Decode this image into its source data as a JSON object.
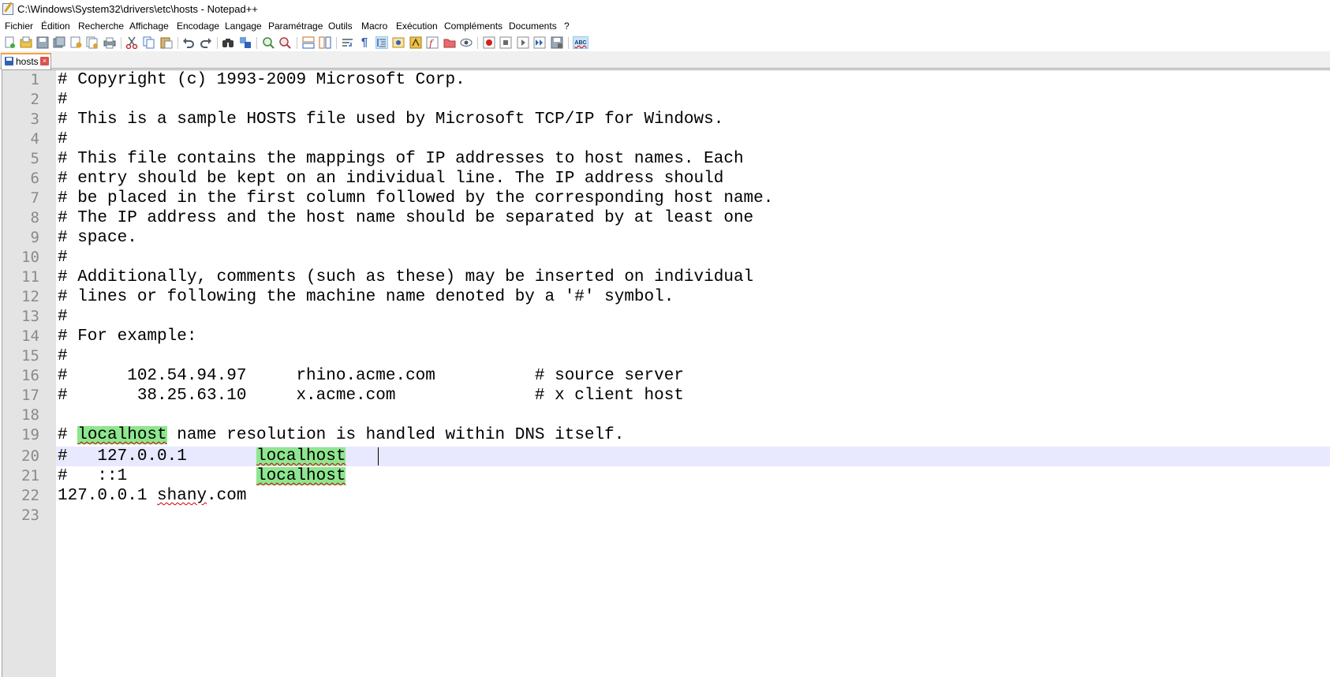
{
  "window": {
    "title": "C:\\Windows\\System32\\drivers\\etc\\hosts - Notepad++"
  },
  "menu": [
    "Fichier",
    "Édition",
    "Recherche",
    "Affichage",
    "Encodage",
    "Langage",
    "Paramétrage",
    "Outils",
    "Macro",
    "Exécution",
    "Compléments",
    "Documents",
    "?"
  ],
  "toolbar": {
    "icons": [
      "new-file-icon",
      "open-file-icon",
      "save-icon",
      "save-all-icon",
      "close-icon",
      "close-all-icon",
      "print-icon",
      "cut-icon",
      "copy-icon",
      "paste-icon",
      "undo-icon",
      "redo-icon",
      "find-icon",
      "replace-icon",
      "zoom-in-icon",
      "zoom-out-icon",
      "sync-vertical-icon",
      "sync-horizontal-icon",
      "word-wrap-icon",
      "show-all-characters-icon",
      "indent-guide-icon",
      "user-language-icon",
      "document-map-icon",
      "function-list-icon",
      "folder-workspace-icon",
      "monitoring-icon",
      "record-macro-icon",
      "stop-macro-icon",
      "play-macro-icon",
      "run-macro-multiple-icon",
      "save-macro-icon",
      "spell-check-icon"
    ],
    "spell_check_label": "ABC"
  },
  "tab": {
    "label": "hosts",
    "close_glyph": "×"
  },
  "editor": {
    "line_numbers": [
      "1",
      "2",
      "3",
      "4",
      "5",
      "6",
      "7",
      "8",
      "9",
      "10",
      "11",
      "12",
      "13",
      "14",
      "15",
      "16",
      "17",
      "18",
      "19",
      "20",
      "21",
      "22",
      "23"
    ],
    "lines": [
      "# Copyright (c) 1993-2009 Microsoft Corp.",
      "#",
      "# This is a sample HOSTS file used by Microsoft TCP/IP for Windows.",
      "#",
      "# This file contains the mappings of IP addresses to host names. Each",
      "# entry should be kept on an individual line. The IP address should",
      "# be placed in the first column followed by the corresponding host name.",
      "# The IP address and the host name should be separated by at least one",
      "# space.",
      "#",
      "# Additionally, comments (such as these) may be inserted on individual",
      "# lines or following the machine name denoted by a '#' symbol.",
      "#",
      "# For example:",
      "#",
      "#      102.54.94.97     rhino.acme.com          # source server",
      "#       38.25.63.10     x.acme.com              # x client host",
      "",
      "",
      "",
      "",
      "",
      ""
    ],
    "line19": {
      "prefix": "# ",
      "highlight": "localhost",
      "suffix": " name resolution is handled within DNS itself."
    },
    "line20": {
      "prefix": "#   127.0.0.1       ",
      "highlight": "localhost"
    },
    "line21": {
      "prefix": "#   ::1             ",
      "highlight": "localhost"
    },
    "line22": {
      "prefix": "127.0.0.1 ",
      "misspelled": "shany",
      "suffix": ".com"
    },
    "current_line": 20
  },
  "colors": {
    "gutter": "#e4e4e4",
    "current_line": "#e8e8ff",
    "smart_highlight": "#8ee68e",
    "tab_accent": "#f9a23a",
    "spell_error": "#d00000"
  }
}
